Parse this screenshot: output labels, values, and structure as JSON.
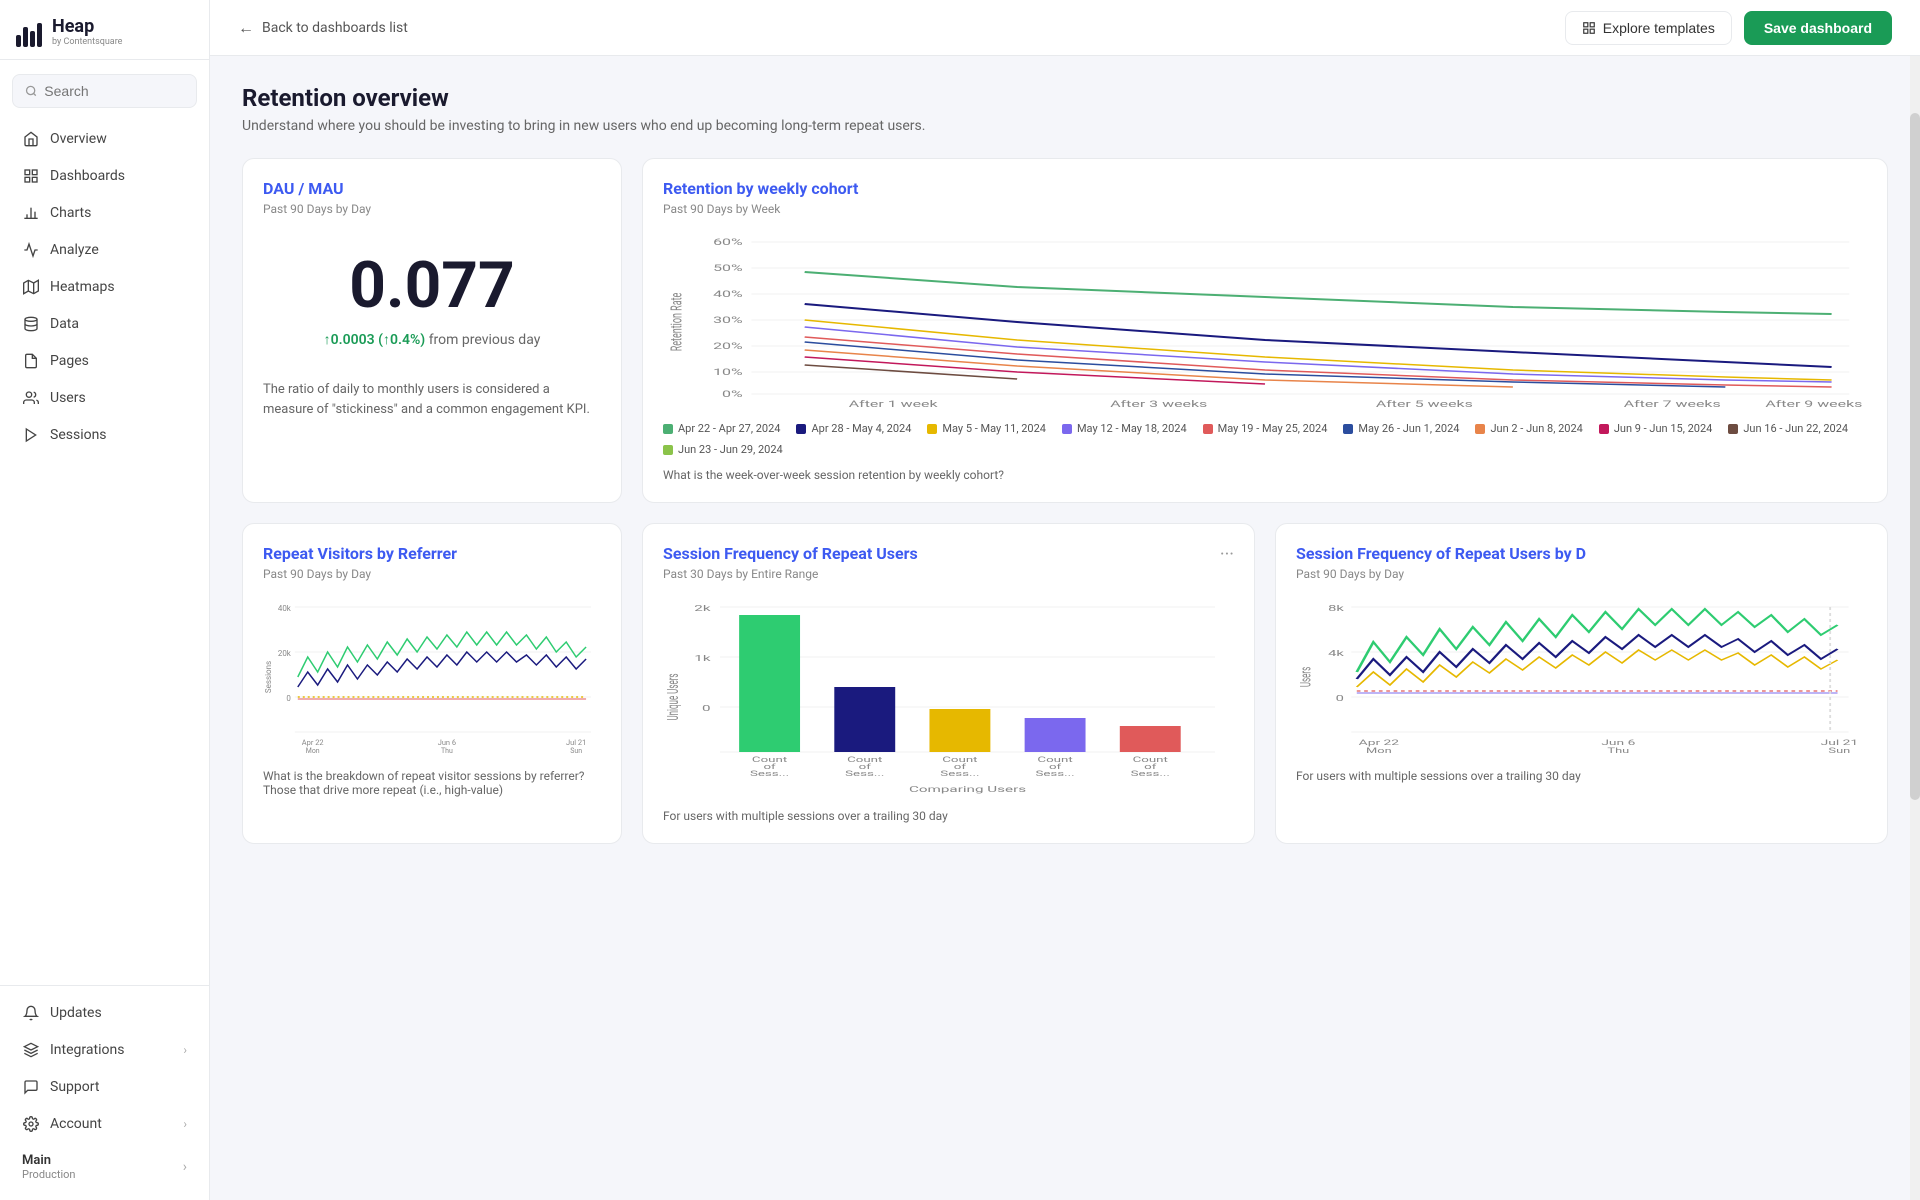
{
  "sidebar": {
    "logo": {
      "name": "Heap",
      "sub": "by Contentsquare"
    },
    "search_placeholder": "Search",
    "nav_items": [
      {
        "id": "overview",
        "label": "Overview",
        "icon": "home"
      },
      {
        "id": "dashboards",
        "label": "Dashboards",
        "icon": "grid"
      },
      {
        "id": "charts",
        "label": "Charts",
        "icon": "bar-chart"
      },
      {
        "id": "analyze",
        "label": "Analyze",
        "icon": "activity"
      },
      {
        "id": "heatmaps",
        "label": "Heatmaps",
        "icon": "map"
      },
      {
        "id": "data",
        "label": "Data",
        "icon": "database"
      },
      {
        "id": "pages",
        "label": "Pages",
        "icon": "file"
      },
      {
        "id": "users",
        "label": "Users",
        "icon": "users"
      },
      {
        "id": "sessions",
        "label": "Sessions",
        "icon": "play"
      }
    ],
    "bottom_items": [
      {
        "id": "updates",
        "label": "Updates",
        "icon": "bell"
      },
      {
        "id": "integrations",
        "label": "Integrations",
        "icon": "layers",
        "has_arrow": true
      },
      {
        "id": "support",
        "label": "Support",
        "icon": "message"
      },
      {
        "id": "account",
        "label": "Account",
        "icon": "settings",
        "has_arrow": true
      }
    ],
    "env": {
      "label": "Main",
      "sub": "Production"
    }
  },
  "header": {
    "back_label": "Back to dashboards list",
    "explore_label": "Explore templates",
    "save_label": "Save dashboard"
  },
  "page": {
    "title": "Retention overview",
    "description": "Understand where you should be investing to bring in new users who end up becoming long-term repeat users."
  },
  "cards": {
    "dau_mau": {
      "title": "DAU / MAU",
      "subtitle": "Past 90 Days by Day",
      "value": "0.077",
      "change_text": "↑0.0003 (↑0.4%) from previous day",
      "description": "The ratio of daily to monthly users is considered a measure of \"stickiness\" and a common engagement KPI."
    },
    "retention": {
      "title": "Retention by weekly cohort",
      "subtitle": "Past 90 Days by Week",
      "question": "What is the week-over-week session retention by weekly cohort?",
      "y_labels": [
        "60%",
        "50%",
        "40%",
        "30%",
        "20%",
        "10%",
        "0%"
      ],
      "x_labels": [
        "After 1 week",
        "After 3 weeks",
        "After 5 weeks",
        "After 7 weeks",
        "After 9 weeks"
      ],
      "y_axis_label": "Retention Rate",
      "legend": [
        {
          "label": "Apr 22 - Apr 27, 2024",
          "color": "#4caf73"
        },
        {
          "label": "Apr 28 - May 4, 2024",
          "color": "#1a1a7e"
        },
        {
          "label": "May 5 - May 11, 2024",
          "color": "#e6b800"
        },
        {
          "label": "May 12 - May 18, 2024",
          "color": "#7b68ee"
        },
        {
          "label": "May 19 - May 25, 2024",
          "color": "#e05a5a"
        },
        {
          "label": "May 26 - Jun 1, 2024",
          "color": "#2b4d9e"
        },
        {
          "label": "Jun 2 - Jun 8, 2024",
          "color": "#e8844a"
        },
        {
          "label": "Jun 9 - Jun 15, 2024",
          "color": "#c2185b"
        },
        {
          "label": "Jun 16 - Jun 22, 2024",
          "color": "#6d4c41"
        },
        {
          "label": "Jun 23 - Jun 29, 2024",
          "color": "#8bc34a"
        }
      ]
    },
    "repeat_visitors": {
      "title": "Repeat Visitors by Referrer",
      "subtitle": "Past 90 Days by Day",
      "question": "What is the breakdown of repeat visitor sessions by referrer? Those that drive more repeat (i.e., high-value)",
      "y_labels": [
        "40k",
        "20k",
        "0"
      ],
      "x_labels": [
        "Apr 22\nMon",
        "Jun 6\nThu",
        "Jul 21\nSun"
      ],
      "y_axis_label": "Sessions"
    },
    "session_freq": {
      "title": "Session Frequency of Repeat Users",
      "subtitle": "Past 30 Days by Entire Range",
      "question": "For users with multiple sessions over a trailing 30 day",
      "y_labels": [
        "2k",
        "1k",
        "0"
      ],
      "x_labels": [
        "Count\nof\nSess...",
        "Count\nof\nSess...",
        "Count\nof\nSess...",
        "Count\nof\nSess...",
        "Count\nof\nSess..."
      ],
      "x_axis_label": "Comparing Users",
      "y_axis_label": "Unique Users",
      "bars": [
        {
          "color": "#2ecc71",
          "height_pct": 95
        },
        {
          "color": "#1a1a7e",
          "height_pct": 38
        },
        {
          "color": "#e6b800",
          "height_pct": 25
        },
        {
          "color": "#7b68ee",
          "height_pct": 20
        },
        {
          "color": "#e05a5a",
          "height_pct": 15
        }
      ]
    },
    "session_freq2": {
      "title": "Session Frequency of Repeat Users by D",
      "subtitle": "Past 90 Days by Day",
      "question": "For users with multiple sessions over a trailing 30 day",
      "y_labels": [
        "8k",
        "4k",
        "0"
      ],
      "x_labels": [
        "Apr 22\nMon",
        "Jun 6\nThu",
        "Jul 21\nSun"
      ],
      "y_axis_label": "Users"
    }
  }
}
